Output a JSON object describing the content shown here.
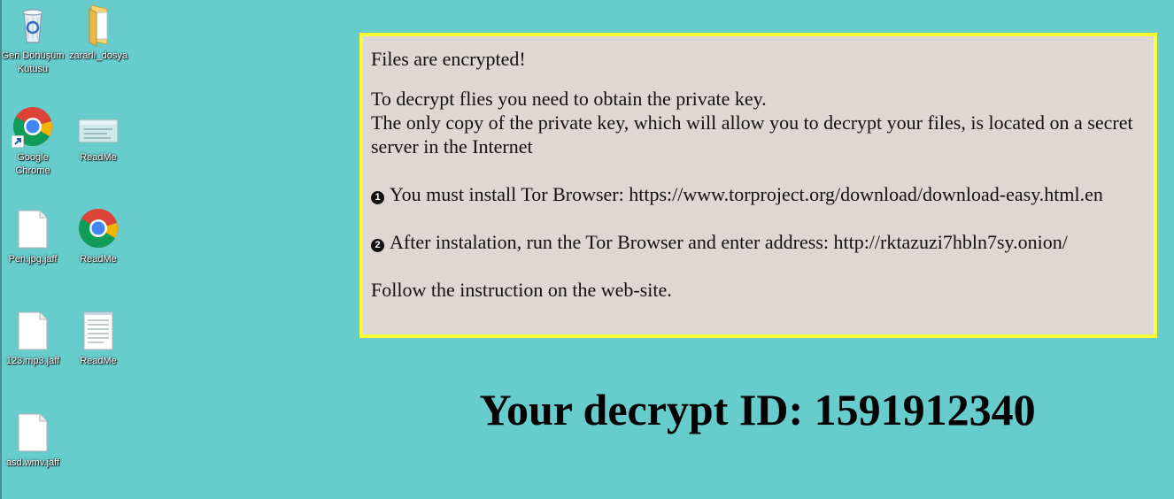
{
  "desktop": {
    "icons": [
      {
        "label": "Geri Dönüşüm Kutusu",
        "icon": "recycle-bin-icon"
      },
      {
        "label": "zararlı_dosya",
        "icon": "folder-icon"
      },
      {
        "label": "Google Chrome",
        "icon": "chrome-icon"
      },
      {
        "label": "ReadMe",
        "icon": "html-file-icon"
      },
      {
        "label": "Pen.jpg.jaff",
        "icon": "file-icon"
      },
      {
        "label": "ReadMe",
        "icon": "chrome-icon"
      },
      {
        "label": "123.mp3.jaff",
        "icon": "file-icon"
      },
      {
        "label": "ReadMe",
        "icon": "text-file-icon"
      },
      {
        "label": "asd.wmv.jaff",
        "icon": "file-icon"
      }
    ]
  },
  "ransom_note": {
    "heading": "Files are encrypted!",
    "line1": "To decrypt flies you need to obtain the private key.",
    "line2": "The only copy of the private key, which will allow you to decrypt your files, is located on a secret server in the Internet",
    "step1_marker": "1",
    "step1": "You must install Tor Browser: https://www.torproject.org/download/download-easy.html.en",
    "step2_marker": "2",
    "step2": "After instalation, run the Tor Browser and enter address: http://rktazuzi7hbln7sy.onion/",
    "footer": "Follow the instruction on the web-site."
  },
  "decrypt_id": {
    "text": "Your decrypt ID: 1591912340"
  },
  "colors": {
    "desktop_background": "#66cccc",
    "note_background": "#dfd7d3",
    "note_border": "#ffff33"
  }
}
